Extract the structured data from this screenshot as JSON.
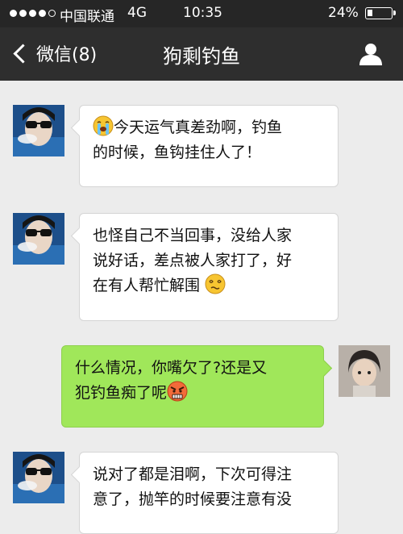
{
  "status_bar": {
    "carrier": "中国联通",
    "network": "4G",
    "time": "10:35",
    "battery_percent": "24%",
    "battery_level": 0.24,
    "signal_bars_filled": 4,
    "signal_bars_total": 5
  },
  "nav": {
    "back_label": "微信(8)",
    "title": "狗剩钓鱼",
    "right_icon": "profile-icon"
  },
  "messages": [
    {
      "side": "incoming",
      "emoji": "crying-face",
      "text": "今天运气真差劲啊，钓鱼的时候，鱼钩挂住人了！",
      "line1": "今天运气真差劲啊，钓鱼",
      "line2": "的时候，鱼钩挂住人了！"
    },
    {
      "side": "incoming",
      "emoji": "dizzy-face",
      "text": "也怪自己不当回事，没给人家说好话，差点被人家打了，好在有人帮忙解围",
      "line1": "也怪自己不当回事，没给人家",
      "line2": "说好话，差点被人家打了，好",
      "line3": "在有人帮忙解围"
    },
    {
      "side": "outgoing",
      "emoji": "angry-face",
      "text": "什么情况，你嘴欠了?还是又犯钓鱼痴了呢",
      "line1": "什么情况，你嘴欠了?还是又",
      "line2": "犯钓鱼痴了呢"
    },
    {
      "side": "incoming",
      "text": "说对了都是泪啊，下次可得注意了，抛竿的时候要注意有没",
      "line1": "说对了都是泪啊，下次可得注",
      "line2": "意了，抛竿的时候要注意有没"
    }
  ],
  "colors": {
    "status_bar_bg": "#262626",
    "nav_bg": "#2e2e2e",
    "chat_bg": "#ececec",
    "incoming_bubble": "#ffffff",
    "outgoing_bubble": "#a0e75a"
  }
}
